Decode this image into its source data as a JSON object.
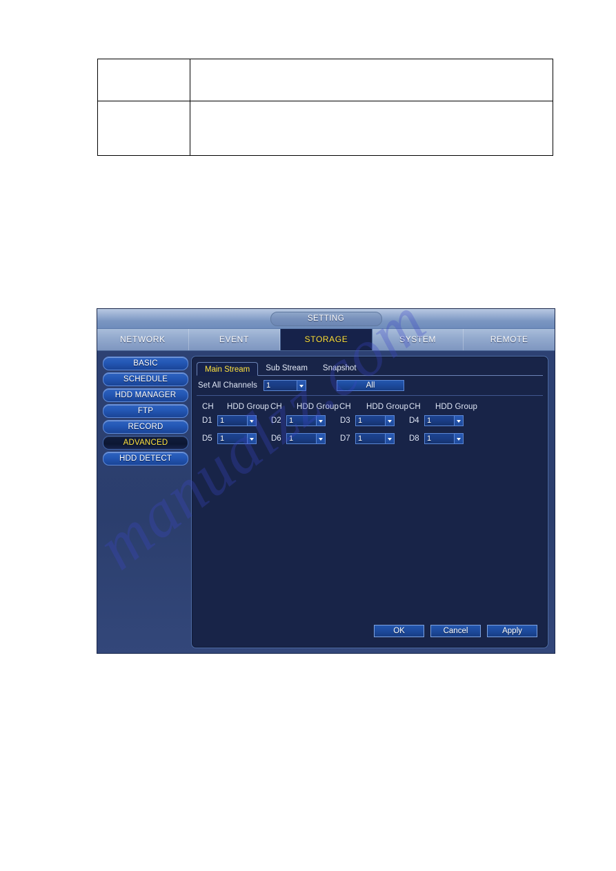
{
  "document_table": {
    "rows": [
      {
        "cells": [
          "",
          ""
        ]
      },
      {
        "cells": [
          "",
          ""
        ]
      }
    ]
  },
  "watermark": {
    "text": "manualzz.com",
    "color": "#3c46c8"
  },
  "dvr": {
    "titlebar": {
      "title": "SETTING"
    },
    "main_menu": {
      "active": "STORAGE",
      "tabs": [
        {
          "label": "NETWORK"
        },
        {
          "label": "EVENT"
        },
        {
          "label": "STORAGE"
        },
        {
          "label": "SYSTEM"
        },
        {
          "label": "REMOTE"
        }
      ]
    },
    "sidebar": {
      "active": "ADVANCED",
      "items": [
        {
          "label": "BASIC"
        },
        {
          "label": "SCHEDULE"
        },
        {
          "label": "HDD MANAGER"
        },
        {
          "label": "FTP"
        },
        {
          "label": "RECORD"
        },
        {
          "label": "ADVANCED"
        },
        {
          "label": "HDD DETECT"
        }
      ]
    },
    "subtabs": {
      "active": "Main Stream",
      "items": [
        {
          "label": "Main Stream"
        },
        {
          "label": "Sub Stream"
        },
        {
          "label": "Snapshot"
        }
      ]
    },
    "set_all": {
      "label": "Set All Channels",
      "value": "1",
      "all_button": "All"
    },
    "column_headers": [
      {
        "label": "CH"
      },
      {
        "label": "HDD Group"
      },
      {
        "label": "CH"
      },
      {
        "label": "HDD Group"
      },
      {
        "label": "CH"
      },
      {
        "label": "HDD Group"
      },
      {
        "label": "CH"
      },
      {
        "label": "HDD Group"
      }
    ],
    "channels": [
      [
        {
          "ch": "D1",
          "group": "1"
        },
        {
          "ch": "D2",
          "group": "1"
        },
        {
          "ch": "D3",
          "group": "1"
        },
        {
          "ch": "D4",
          "group": "1"
        }
      ],
      [
        {
          "ch": "D5",
          "group": "1"
        },
        {
          "ch": "D6",
          "group": "1"
        },
        {
          "ch": "D7",
          "group": "1"
        },
        {
          "ch": "D8",
          "group": "1"
        }
      ]
    ],
    "footer": {
      "ok": "OK",
      "cancel": "Cancel",
      "apply": "Apply"
    },
    "colors": {
      "accent_yellow": "#ffe23d",
      "panel_bg": "#182448",
      "window_bg": "#2d4173",
      "button_blue": "#1d4a9c"
    }
  }
}
